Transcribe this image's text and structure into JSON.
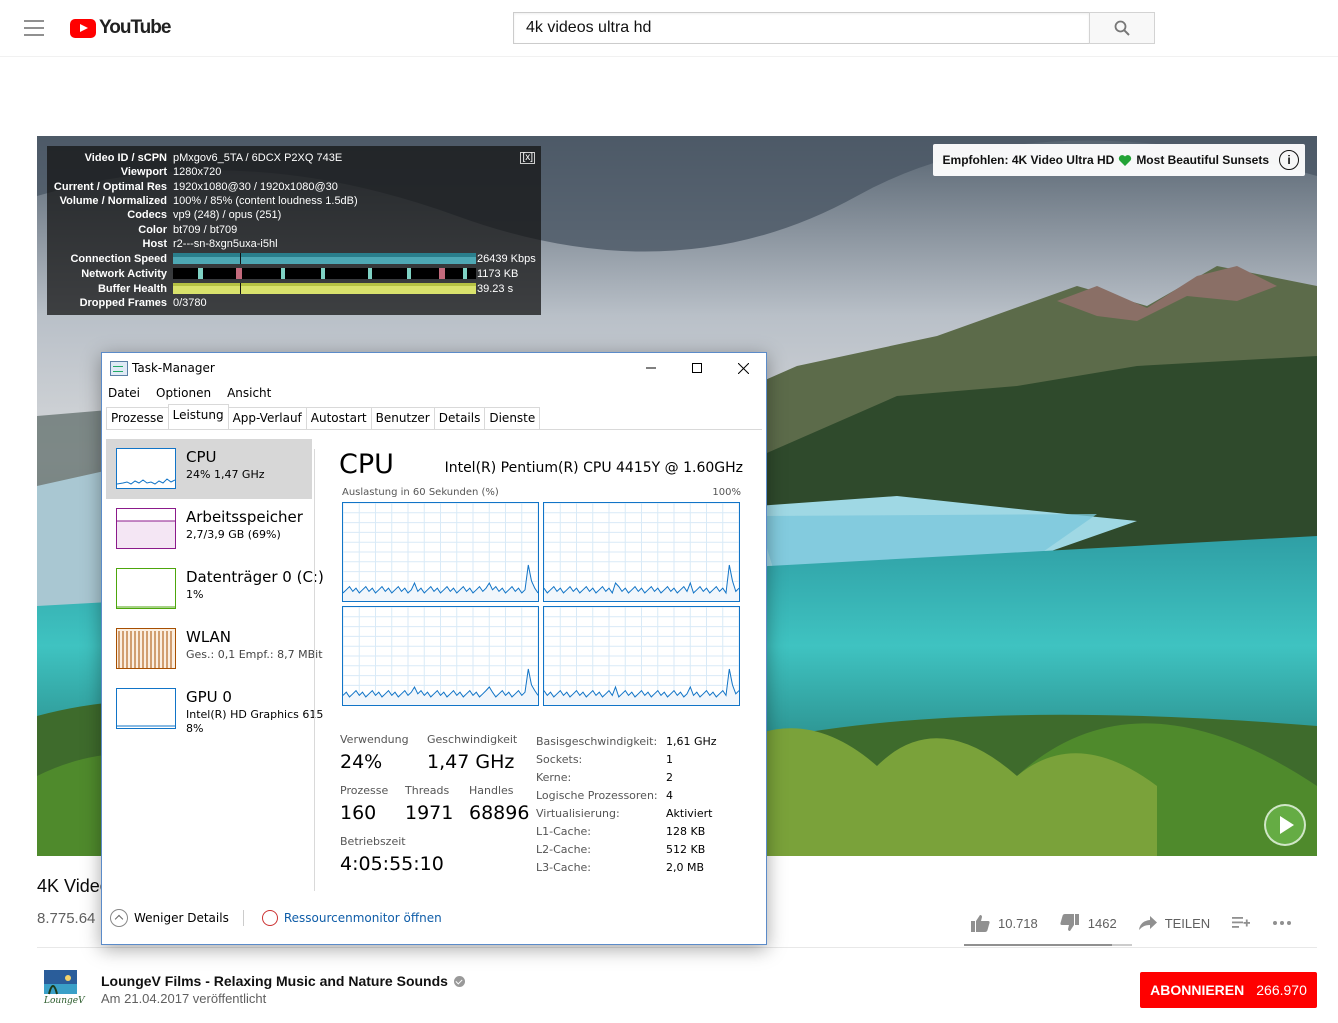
{
  "masthead": {
    "logo_text": "YouTube",
    "search_value": "4k videos ultra hd"
  },
  "stats": {
    "rows": [
      {
        "k": "Video ID / sCPN",
        "v": "pMxgov6_5TA / 6DCX P2XQ 743E"
      },
      {
        "k": "Viewport",
        "v": "1280x720"
      },
      {
        "k": "Current / Optimal Res",
        "v": "1920x1080@30 / 1920x1080@30"
      },
      {
        "k": "Volume / Normalized",
        "v": "100% / 85% (content loudness 1.5dB)"
      },
      {
        "k": "Codecs",
        "v": "vp9 (248) / opus (251)"
      },
      {
        "k": "Color",
        "v": "bt709 / bt709"
      },
      {
        "k": "Host",
        "v": "r2---sn-8xgn5uxa-i5hl"
      },
      {
        "k": "Connection Speed",
        "v": "26439 Kbps"
      },
      {
        "k": "Network Activity",
        "v": "1173 KB"
      },
      {
        "k": "Buffer Health",
        "v": "39.23 s"
      },
      {
        "k": "Dropped Frames",
        "v": "0/3780"
      }
    ],
    "close": "[x]"
  },
  "recommendation": {
    "text_a": "Empfohlen: 4K Video Ultra HD",
    "text_b": "Most Beautiful Sunsets",
    "info_glyph": "i"
  },
  "video": {
    "title": "4K Video",
    "views": "8.775.64",
    "likes": "10.718",
    "dislikes": "1462",
    "share": "TEILEN",
    "like_ratio": 0.88
  },
  "channel": {
    "name": "LoungeV Films - Relaxing Music and Nature Sounds",
    "published": "Am 21.04.2017 veröffentlicht",
    "subscribe": "ABONNIEREN",
    "subscribers": "266.970",
    "logo_text": "LoungeV"
  },
  "taskmanager": {
    "title": "Task-Manager",
    "menu": [
      "Datei",
      "Optionen",
      "Ansicht"
    ],
    "tabs": [
      "Prozesse",
      "Leistung",
      "App-Verlauf",
      "Autostart",
      "Benutzer",
      "Details",
      "Dienste"
    ],
    "resources": [
      {
        "name": "CPU",
        "sub": "24%  1,47 GHz",
        "color": "#1174c7"
      },
      {
        "name": "Arbeitsspeicher",
        "sub": "2,7/3,9 GB (69%)",
        "color": "#8b1a8b"
      },
      {
        "name": "Datenträger 0 (C:)",
        "sub": "1%",
        "color": "#4da60c"
      },
      {
        "name": "WLAN",
        "sub": "Ges.: 0,1  Empf.: 8,7 MBit",
        "color": "#a74f01"
      },
      {
        "name": "GPU 0",
        "sub": "Intel(R) HD Graphics 615",
        "sub2": "8%",
        "color": "#1174c7"
      }
    ],
    "heading": "CPU",
    "cpu_model": "Intel(R) Pentium(R) CPU 4415Y @ 1.60GHz",
    "graph_caption": "Auslastung in 60 Sekunden (%)",
    "graph_max": "100%",
    "stats": {
      "verwendung_label": "Verwendung",
      "verwendung": "24%",
      "geschw_label": "Geschwindigkeit",
      "geschw": "1,47 GHz",
      "prozesse_label": "Prozesse",
      "prozesse": "160",
      "threads_label": "Threads",
      "threads": "1971",
      "handles_label": "Handles",
      "handles": "68896",
      "uptime_label": "Betriebszeit",
      "uptime": "4:05:55:10"
    },
    "details": [
      {
        "k": "Basisgeschwindigkeit:",
        "v": "1,61 GHz"
      },
      {
        "k": "Sockets:",
        "v": "1"
      },
      {
        "k": "Kerne:",
        "v": "2"
      },
      {
        "k": "Logische Prozessoren:",
        "v": "4"
      },
      {
        "k": "Virtualisierung:",
        "v": "Aktiviert"
      },
      {
        "k": "L1-Cache:",
        "v": "128 KB"
      },
      {
        "k": "L2-Cache:",
        "v": "512 KB"
      },
      {
        "k": "L3-Cache:",
        "v": "2,0 MB"
      }
    ],
    "fewer_details": "Weniger Details",
    "resource_monitor": "Ressourcenmonitor öffnen"
  }
}
